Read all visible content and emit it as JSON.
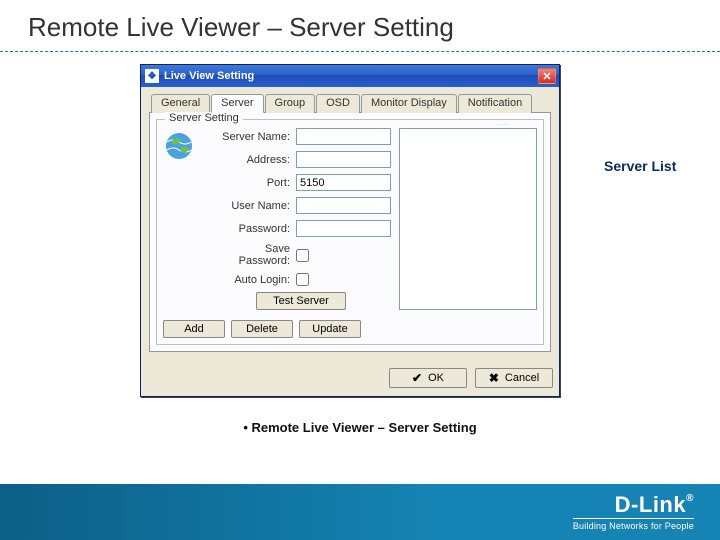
{
  "slide": {
    "title": "Remote Live Viewer – Server Setting",
    "caption": "• Remote Live Viewer – Server Setting",
    "callout": "Server List"
  },
  "dialog": {
    "title": "Live View Setting",
    "tabs": {
      "general": "General",
      "server": "Server",
      "group": "Group",
      "osd": "OSD",
      "monitor": "Monitor Display",
      "notification": "Notification"
    },
    "group_legend": "Server Setting",
    "fields": {
      "server_name_label": "Server Name:",
      "server_name_value": "",
      "address_label": "Address:",
      "address_value": "",
      "port_label": "Port:",
      "port_value": "5150",
      "user_label": "User Name:",
      "user_value": "",
      "password_label": "Password:",
      "password_value": "",
      "savepw_label": "Save Password:",
      "autologin_label": "Auto Login:"
    },
    "buttons": {
      "test": "Test Server",
      "add": "Add",
      "delete": "Delete",
      "update": "Update",
      "ok": "OK",
      "cancel": "Cancel"
    }
  },
  "brand": {
    "logo": "D-Link",
    "tagline": "Building Networks for People"
  }
}
